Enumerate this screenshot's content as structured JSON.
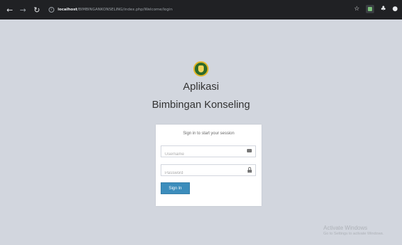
{
  "browser": {
    "url_host": "localhost",
    "url_path": "/BIMBINGANKONSELING/index.php/Welcome/login",
    "icons": [
      "back-arrow-icon",
      "forward-arrow-icon",
      "reload-icon",
      "site-info-icon",
      "star-icon",
      "extension-icon",
      "puzzle-icon",
      "profile-icon"
    ]
  },
  "brand": {
    "line1": "Aplikasi",
    "line2": "Bimbingan Konseling"
  },
  "login": {
    "message": "Sign in to start your session",
    "username_placeholder": "Username",
    "password_placeholder": "Password",
    "signin_label": "Sign In"
  },
  "watermark": {
    "line1": "Activate Windows",
    "line2": "Go to Settings to activate Windows."
  },
  "colors": {
    "page_bg": "#d2d6de",
    "chrome_bg": "#202124",
    "button_primary": "#3c8dbc"
  }
}
